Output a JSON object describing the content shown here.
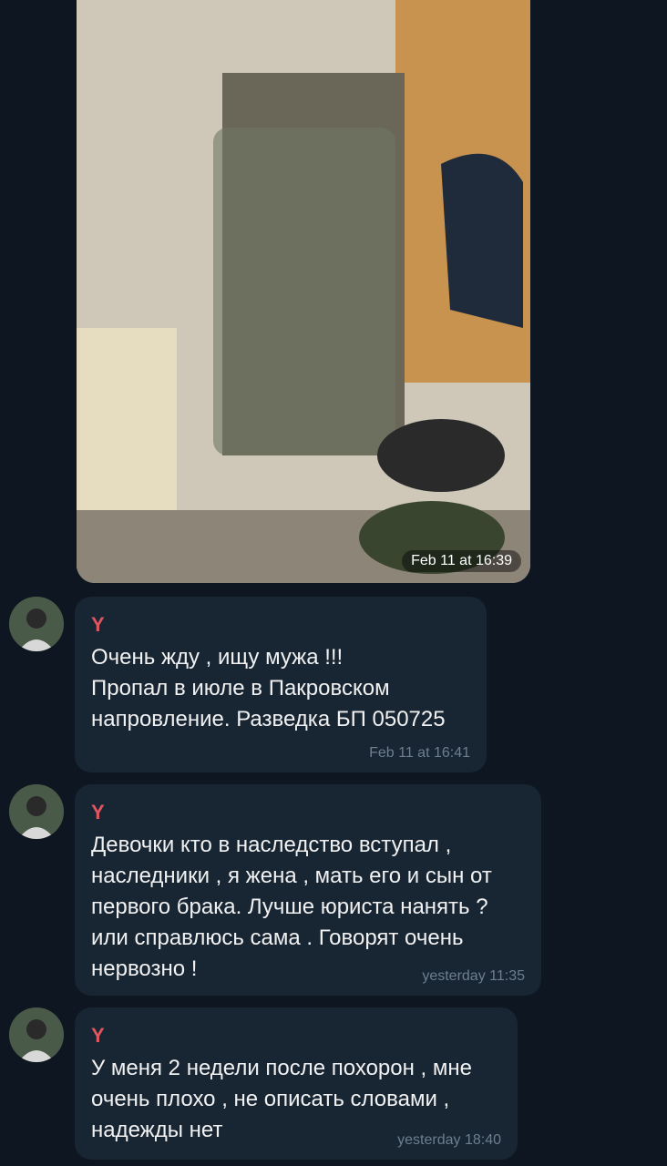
{
  "photo_message": {
    "time": "Feb 11 at 16:39"
  },
  "messages": [
    {
      "sender": "Y",
      "text": "Очень жду , ищу мужа !!!\nПропал в июле в Пакровском\nнапровление. Разведка БП 050725",
      "time": "Feb 11 at 16:41"
    },
    {
      "sender": "Y",
      "text": "Девочки кто в наследство вступал ,\nнаследники , я жена , мать его и сын от\nпервого брака. Лучше юриста нанять ?\nили справлюсь сама . Говорят очень\nнервозно !",
      "time": "yesterday 11:35"
    },
    {
      "sender": "Y",
      "text": "У меня 2 недели после похорон , мне\nочень плохо , не описать словами ,\nнадежды нет",
      "time": "yesterday 18:40"
    }
  ],
  "colors": {
    "background": "#0e1621",
    "bubble": "#182533",
    "sender_name": "#e0555f",
    "timestamp": "#6d7f8f"
  }
}
